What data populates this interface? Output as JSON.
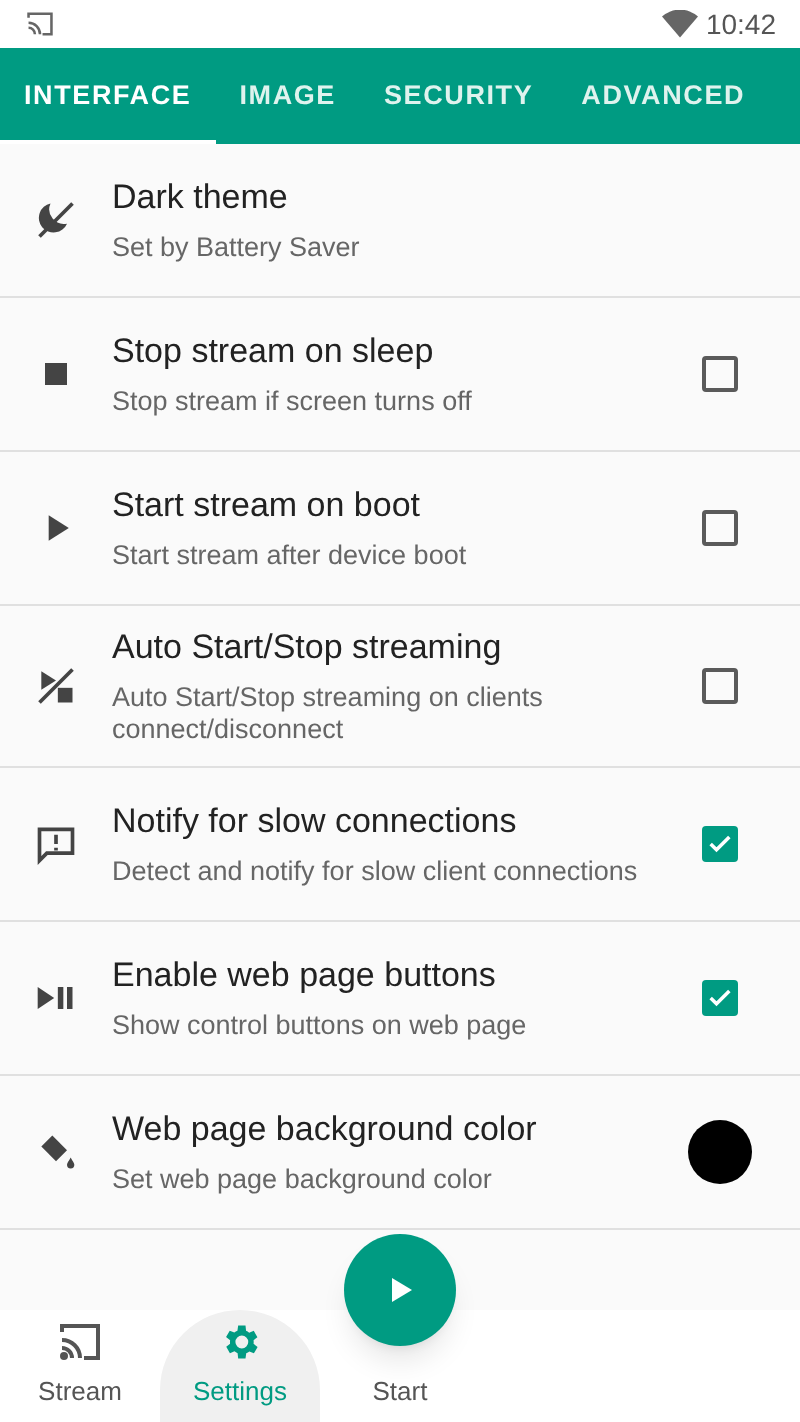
{
  "status_bar": {
    "time": "10:42"
  },
  "tabs": [
    {
      "label": "INTERFACE",
      "selected": true
    },
    {
      "label": "IMAGE",
      "selected": false
    },
    {
      "label": "SECURITY",
      "selected": false
    },
    {
      "label": "ADVANCED",
      "selected": false
    }
  ],
  "settings": [
    {
      "kind": "plain",
      "title": "Dark theme",
      "summary": "Set by Battery Saver"
    },
    {
      "kind": "checkbox",
      "title": "Stop stream on sleep",
      "summary": "Stop stream if screen turns off",
      "checked": false
    },
    {
      "kind": "checkbox",
      "title": "Start stream on boot",
      "summary": "Start stream after device boot",
      "checked": false
    },
    {
      "kind": "checkbox",
      "title": "Auto Start/Stop streaming",
      "summary": "Auto Start/Stop streaming on clients connect/disconnect",
      "checked": false
    },
    {
      "kind": "checkbox",
      "title": "Notify for slow connections",
      "summary": "Detect and notify for slow client connections",
      "checked": true
    },
    {
      "kind": "checkbox",
      "title": "Enable web page buttons",
      "summary": "Show control buttons on web page",
      "checked": true
    },
    {
      "kind": "color",
      "title": "Web page background color",
      "summary": "Set web page background color",
      "color": "#000000"
    }
  ],
  "bottom_nav": [
    {
      "kind": "stream",
      "label": "Stream",
      "selected": false
    },
    {
      "kind": "settings",
      "label": "Settings",
      "selected": true
    },
    {
      "kind": "start",
      "label": "Start",
      "selected": false
    }
  ]
}
